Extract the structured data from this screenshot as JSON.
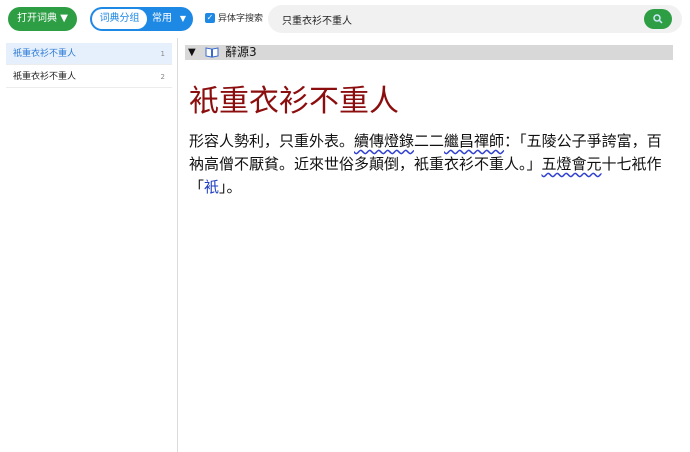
{
  "toolbar": {
    "open_dict_label": "打开词典 ▼",
    "group_left_label": "词典分组",
    "group_right_label": "常用",
    "variant_search_label": "异体字搜索",
    "variant_search_checked": true,
    "search_value": "只重衣衫不重人"
  },
  "sidebar": {
    "items": [
      {
        "label": "衹重衣衫不重人",
        "num": "1",
        "selected": true
      },
      {
        "label": "衹重衣衫不重人",
        "num": "2",
        "selected": false
      }
    ]
  },
  "content": {
    "dict_name": "辭源3",
    "headword": "衹重衣衫不重人",
    "def_part1": "形容人勢利，只重外表。",
    "def_src1": "續傳燈錄",
    "def_part2": "二二",
    "def_src2": "繼昌禪師",
    "def_part3": "：「五陵公子爭誇富，百衲高僧不厭貧。近來世俗多顛倒，衹重衣衫不重人。」",
    "def_src3": "五燈會元",
    "def_part4": "十七衹作「",
    "def_link": "衹",
    "def_part5": "」。"
  },
  "colors": {
    "accent_green": "#2e9e45",
    "accent_blue": "#1e88e5",
    "headword_red": "#8b0d0d"
  }
}
